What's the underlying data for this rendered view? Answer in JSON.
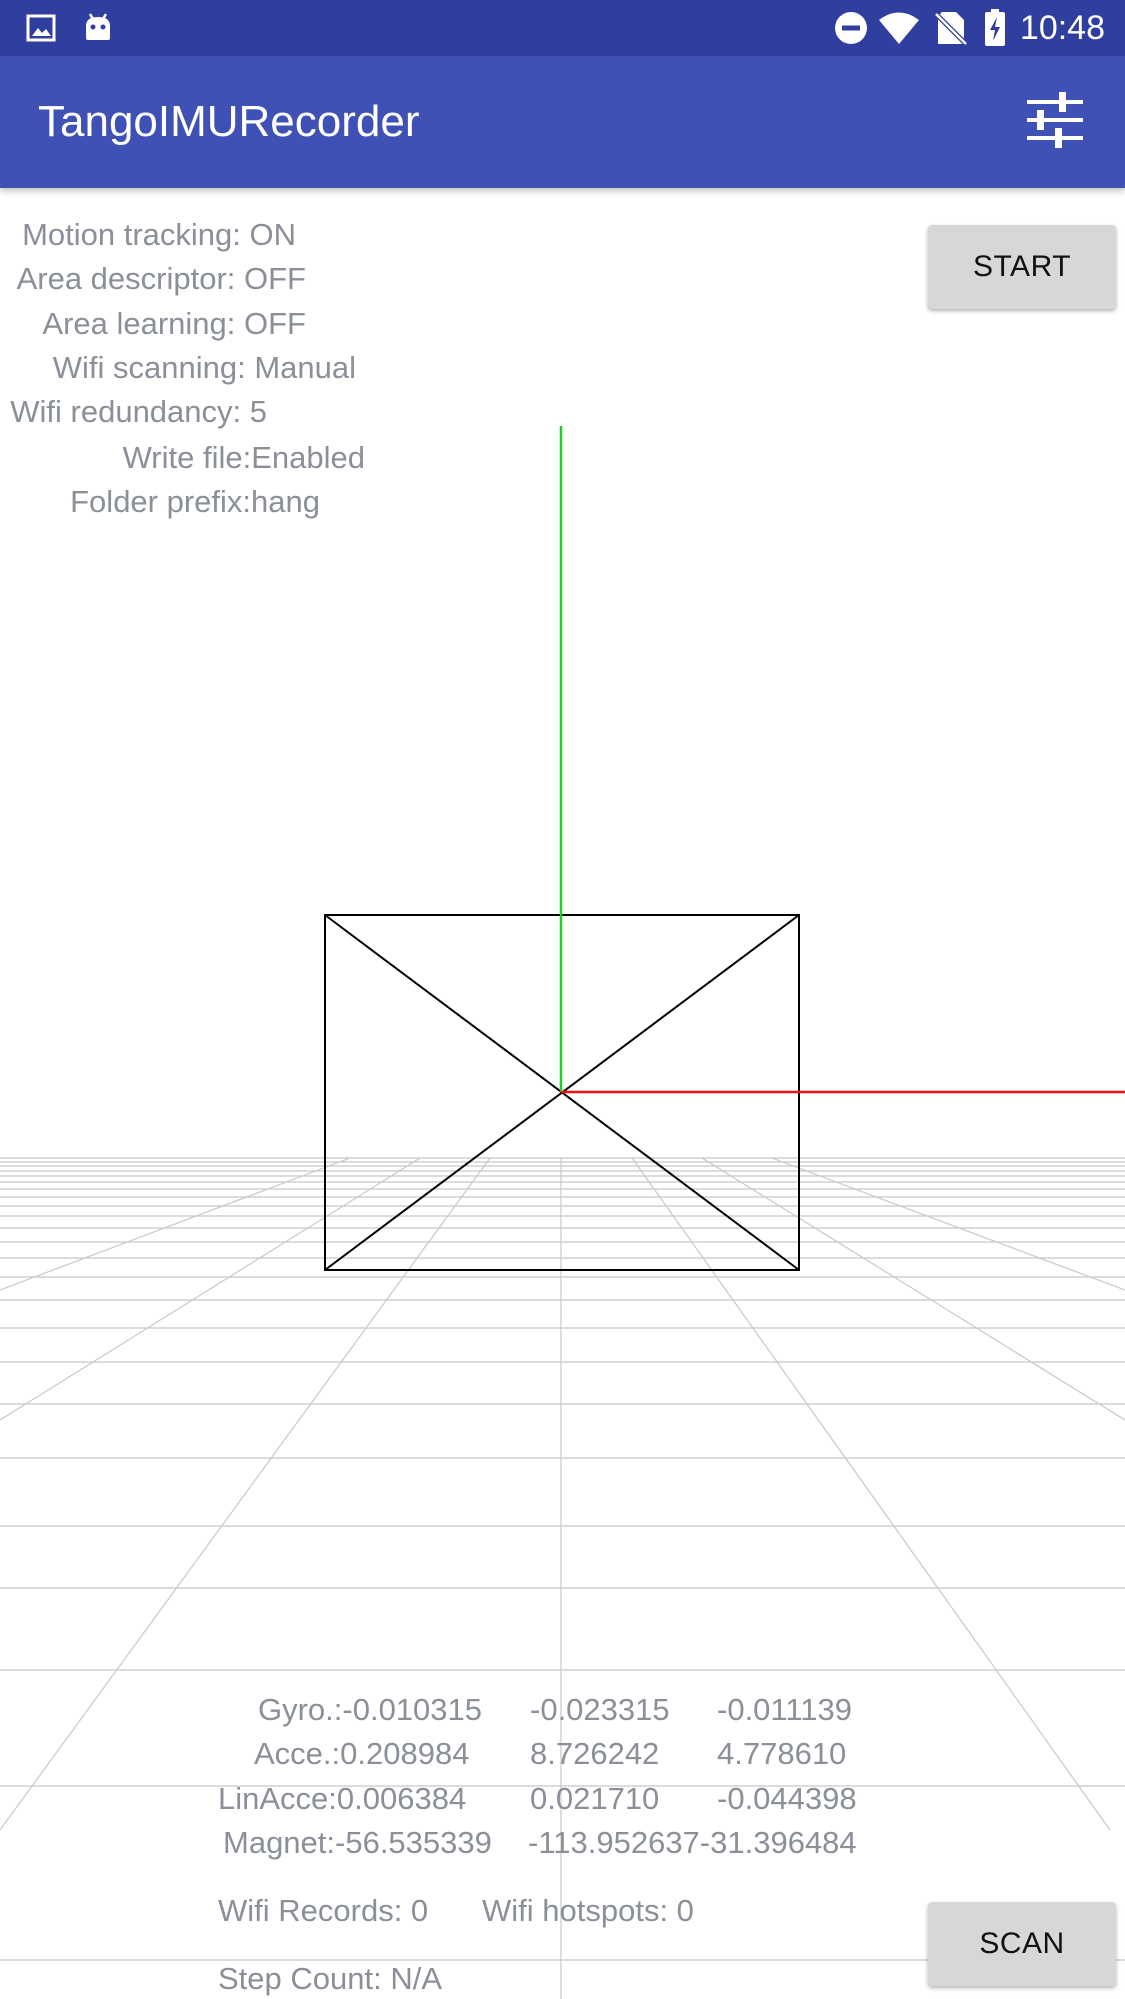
{
  "status_bar": {
    "time": "10:48",
    "icons": [
      "image-icon",
      "android-icon",
      "do-not-disturb-icon",
      "wifi-icon",
      "no-sim-icon",
      "battery-charging-icon"
    ]
  },
  "app_bar": {
    "title": "TangoIMURecorder",
    "settings_icon": "sliders-icon"
  },
  "status_info": {
    "motion_tracking": "Motion tracking: ON",
    "area_descriptor": "Area descriptor: OFF",
    "area_learning": "Area learning: OFF",
    "wifi_scanning": "Wifi scanning: Manual",
    "wifi_redundancy": "Wifi redundancy: 5",
    "write_file": "Write file:Enabled",
    "folder_prefix": "Folder prefix:hang"
  },
  "buttons": {
    "start": "START",
    "scan": "SCAN"
  },
  "sensors": {
    "gyro": {
      "label": "Gyro.:-0.010315",
      "v2": "-0.023315",
      "v3": "-0.011139"
    },
    "acce": {
      "label": "Acce.:0.208984",
      "v2": "8.726242",
      "v3": "4.778610"
    },
    "linacce": {
      "label": "LinAcce:0.006384",
      "v2": "0.021710",
      "v3": "-0.044398"
    },
    "magnet": {
      "label": "Magnet:-56.535339",
      "v2": "-113.952637-31.396484"
    }
  },
  "wifi": {
    "records": "Wifi Records: 0",
    "hotspots": "Wifi hotspots: 0"
  },
  "step_count": "Step Count: N/A",
  "colors": {
    "status_bar": "#303f9f",
    "app_bar": "#3f51b5",
    "y_axis": "#22cc22",
    "x_axis": "#ee1111",
    "grid": "#c8c8c8"
  }
}
